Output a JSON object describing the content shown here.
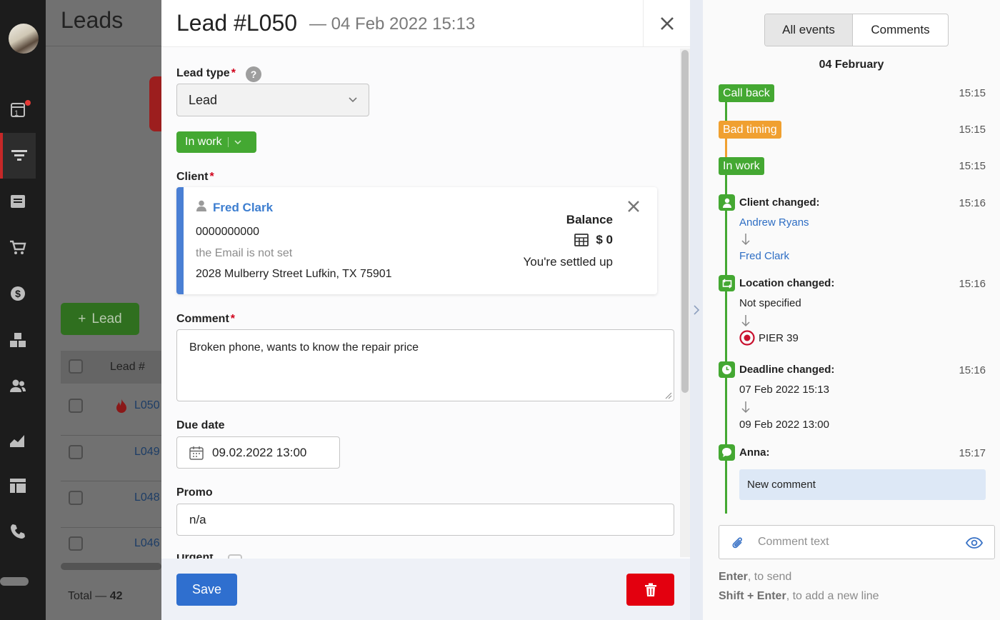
{
  "nav": {
    "badge_count": "1",
    "icons": [
      "calendar-icon",
      "funnel-icon",
      "inbox-icon",
      "cart-icon",
      "dollar-icon",
      "boxes-icon",
      "users-icon",
      "chart-icon",
      "dashboard-icon",
      "phone-icon"
    ]
  },
  "background_page": {
    "title": "Leads",
    "add_button_label": "Lead",
    "column_lead_number": "Lead #",
    "rows": [
      "L050",
      "L049",
      "L048",
      "L046"
    ],
    "total_label": "Total — ",
    "total_value": "42"
  },
  "modal": {
    "title": "Lead #L050",
    "subtitle": "— 04 Feb 2022 15:13",
    "lead_type": {
      "label": "Lead type",
      "required": "*",
      "value": "Lead"
    },
    "status": {
      "label": "In work",
      "color": "#44a832"
    },
    "client": {
      "label": "Client",
      "required": "*",
      "name": "Fred Clark",
      "phone": "0000000000",
      "email": "the Email is not set",
      "address": "2028 Mulberry Street Lufkin, TX 75901",
      "balance_label": "Balance",
      "balance_value": "$ 0",
      "balance_status": "You're settled up"
    },
    "comment": {
      "label": "Comment",
      "required": "*",
      "value": "Broken phone, wants to know the repair price"
    },
    "due_date": {
      "label": "Due date",
      "value": "09.02.2022 13:00"
    },
    "promo": {
      "label": "Promo",
      "value": "n/a"
    },
    "next_field_label": "Urgent",
    "save_label": "Save"
  },
  "events_panel": {
    "tabs": [
      "All events",
      "Comments"
    ],
    "active_tab": "All events",
    "date_header": "04 February",
    "status_events": [
      {
        "label": "Call back",
        "time": "15:15",
        "color": "#44a832"
      },
      {
        "label": "Bad timing",
        "time": "15:15",
        "color": "#f0a030"
      },
      {
        "label": "In work",
        "time": "15:15",
        "color": "#44a832"
      }
    ],
    "client_changed": {
      "title": "Client changed:",
      "time": "15:16",
      "from": "Andrew Ryans",
      "to": "Fred Clark"
    },
    "location_changed": {
      "title": "Location changed:",
      "time": "15:16",
      "from": "Not specified",
      "to": "PIER 39"
    },
    "deadline_changed": {
      "title": "Deadline changed:",
      "time": "15:16",
      "from": "07 Feb 2022 15:13",
      "to": "09 Feb 2022 13:00"
    },
    "comment_event": {
      "author": "Anna:",
      "time": "15:17",
      "text": "New comment"
    },
    "comment_input": {
      "placeholder": "Comment text"
    },
    "hint_send_key": "Enter",
    "hint_send_text": ", to send",
    "hint_newline_key": "Shift + Enter",
    "hint_newline_text": ", to add a new line"
  }
}
